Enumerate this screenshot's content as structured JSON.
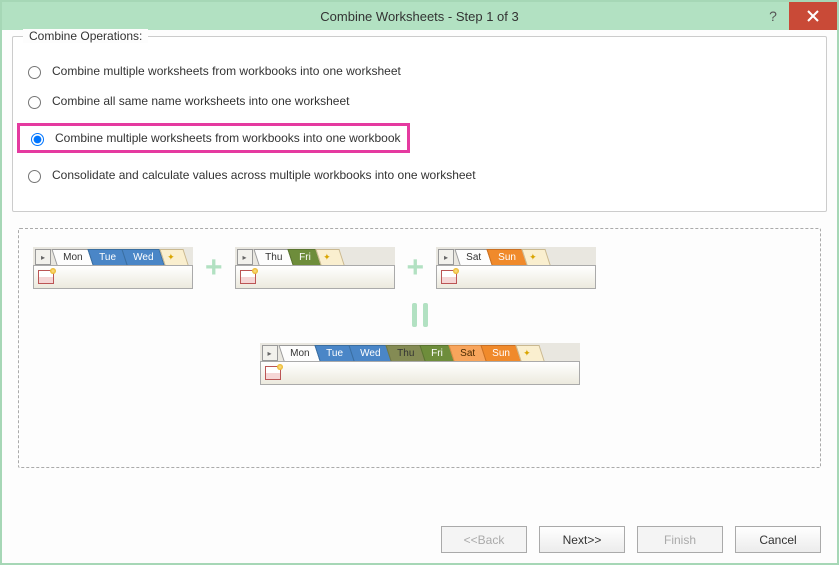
{
  "dialog": {
    "title": "Combine Worksheets - Step 1 of 3"
  },
  "operations": {
    "legend": "Combine Operations:",
    "options": [
      {
        "label": "Combine multiple worksheets from workbooks into one worksheet"
      },
      {
        "label": "Combine all same name worksheets into one worksheet"
      },
      {
        "label": "Combine multiple worksheets from workbooks into one workbook"
      },
      {
        "label": "Consolidate and calculate values across multiple workbooks into one worksheet"
      }
    ],
    "selected_index": 2
  },
  "diagram": {
    "wb1": [
      "Mon",
      "Tue",
      "Wed"
    ],
    "wb2": [
      "Thu",
      "Fri"
    ],
    "wb3": [
      "Sat",
      "Sun"
    ],
    "result": [
      "Mon",
      "Tue",
      "Wed",
      "Thu",
      "Fri",
      "Sat",
      "Sun"
    ]
  },
  "buttons": {
    "back": "<<Back",
    "next": "Next>>",
    "finish": "Finish",
    "cancel": "Cancel"
  }
}
